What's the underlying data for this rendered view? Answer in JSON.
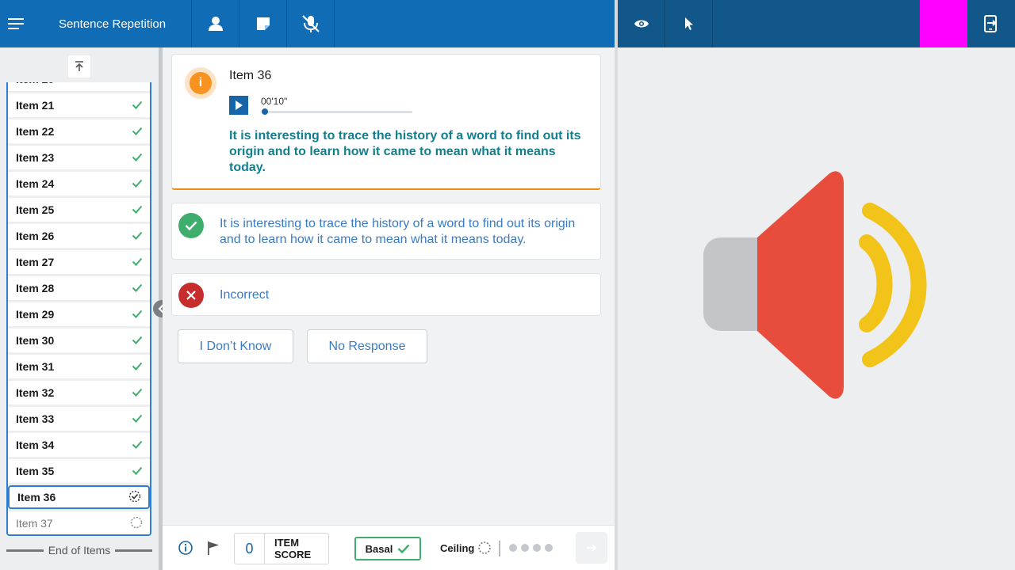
{
  "header": {
    "title": "Sentence Repetition",
    "accent_color": "#0f6cb5",
    "examinee_panel_color": "#12578a",
    "marker_color": "#ff00ff",
    "icons": [
      "menu-icon",
      "person-icon",
      "note-icon",
      "mic-off-icon",
      "eye-icon",
      "pointer-icon",
      "exit-screen-icon"
    ]
  },
  "sidebar": {
    "items": [
      {
        "label": "Item 21",
        "status": "complete"
      },
      {
        "label": "Item 22",
        "status": "complete"
      },
      {
        "label": "Item 23",
        "status": "complete"
      },
      {
        "label": "Item 24",
        "status": "complete"
      },
      {
        "label": "Item 25",
        "status": "complete"
      },
      {
        "label": "Item 26",
        "status": "complete"
      },
      {
        "label": "Item 27",
        "status": "complete"
      },
      {
        "label": "Item 28",
        "status": "complete"
      },
      {
        "label": "Item 29",
        "status": "complete"
      },
      {
        "label": "Item 30",
        "status": "complete"
      },
      {
        "label": "Item 31",
        "status": "complete"
      },
      {
        "label": "Item 32",
        "status": "complete"
      },
      {
        "label": "Item 33",
        "status": "complete"
      },
      {
        "label": "Item 34",
        "status": "complete"
      },
      {
        "label": "Item 35",
        "status": "complete"
      },
      {
        "label": "Item 36",
        "status": "current"
      },
      {
        "label": "Item 37",
        "status": "pending"
      }
    ],
    "end_label": "End of Items"
  },
  "question": {
    "title": "Item 36",
    "info_glyph": "i",
    "audio_time": "00'10\"",
    "audio_progress": 0.0,
    "prompt": "It is interesting to trace the history of a word to find out its origin and to learn how it came to mean what it means today."
  },
  "responses": {
    "correct_text": "It is interesting to trace the history of a word to find out its origin and to learn how it came to mean what it means today.",
    "incorrect_text": "Incorrect",
    "dont_know_label": "I Don’t Know",
    "no_response_label": "No Response"
  },
  "footer": {
    "item_score": "0",
    "item_score_label": "ITEM SCORE",
    "basal_label": "Basal",
    "ceiling_label": "Ceiling",
    "ceiling_dots": 4
  }
}
